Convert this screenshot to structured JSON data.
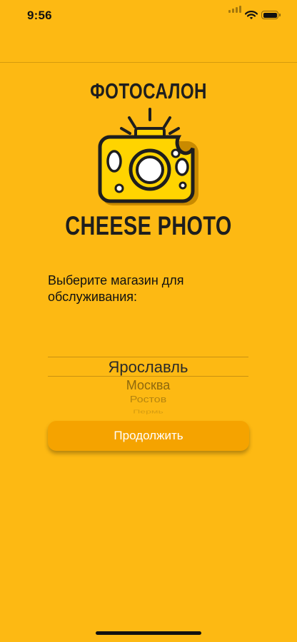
{
  "status_bar": {
    "time": "9:56",
    "icons": [
      "cellular-signal-icon",
      "wifi-icon",
      "battery-icon"
    ]
  },
  "logo": {
    "top_text": "ФОТОСАЛОН",
    "bottom_text": "CHEESE PHOTO",
    "icon": "cheese-camera-icon"
  },
  "prompt": "Выберите магазин для обслуживания:",
  "picker": {
    "selected": "Ярославль",
    "options": [
      "Москва",
      "Ростов",
      "Пермь"
    ]
  },
  "continue_label": "Продолжить",
  "colors": {
    "background": "#FDB913",
    "button": "#F5A300",
    "camera_body": "#FFD400"
  }
}
